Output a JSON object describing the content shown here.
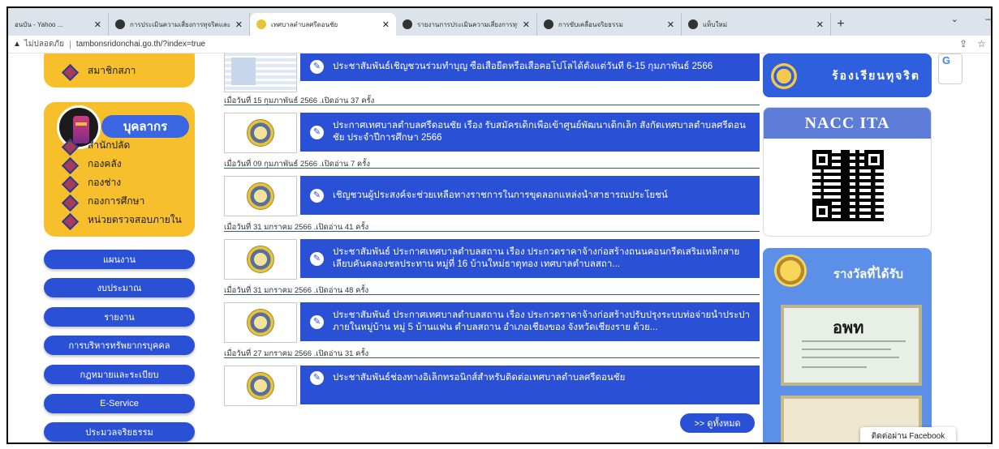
{
  "browser": {
    "tabs": [
      {
        "label": "อนบัน - Yahoo ...",
        "icon": "yahoo-icon",
        "color": "#6001d2"
      },
      {
        "label": "การประเมินความเสี่ยงการทุจริตและ...",
        "icon": "chrome-icon",
        "color": "#333333"
      },
      {
        "label": "เทศบาลตำบลศรีดอนชัย",
        "icon": "site-icon",
        "color": "#e8c33a",
        "active": true
      },
      {
        "label": "รายงานการประเมินความเสี่ยงการทุจ...",
        "icon": "chrome-icon",
        "color": "#333333"
      },
      {
        "label": "การขับเคลื่อนจริยธรรม",
        "icon": "chrome-icon",
        "color": "#333333"
      },
      {
        "label": "แท็บใหม่",
        "icon": "chrome-icon",
        "color": "#333333"
      }
    ],
    "new_tab": "+",
    "address": {
      "insecure_label": "ไม่ปลอดภัย",
      "url": "tambonsridonchai.go.th/?index=true"
    }
  },
  "sidebar": {
    "top_item": "สมาชิกสภา",
    "section_title": "บุคลากร",
    "items": [
      "สำนักปลัด",
      "กองคลัง",
      "กองช่าง",
      "กองการศึกษา",
      "หน่วยตรวจสอบภายใน"
    ],
    "buttons": [
      "แผนงาน",
      "งบประมาณ",
      "รายงาน",
      "การบริหารทรัพยากรบุคคล",
      "กฎหมายและระเบียบ",
      "E-Service",
      "ประมวลจริยธรรม"
    ]
  },
  "news": [
    {
      "title": "ประชาสัมพันธ์เชิญชวนร่วมทำบุญ ซื้อเสื้อยืดหรือเสื้อคอโปโลได้ตั้งแต่วันที่ 6-15 กุมภาพันธ์ 2566",
      "meta": "เมื่อวันที่ 15 กุมภาพันธ์ 2566 .เปิดอ่าน 37 ครั้ง",
      "thumb": "doc"
    },
    {
      "title": "ประกาศเทศบาลตำบลศรีดอนชัย เรื่อง รับสมัครเด็กเพื่อเข้าศูนย์พัฒนาเด็กเล็ก สังกัดเทศบาลตำบลศรีดอนชัย ประจำปีการศึกษา 2566",
      "meta": "เมื่อวันที่ 09 กุมภาพันธ์ 2566 .เปิดอ่าน 7 ครั้ง",
      "thumb": "seal"
    },
    {
      "title": "เชิญชวนผู้ประสงค์จะช่วยเหลือทางราชการในการขุดลอกแหล่งน้ำสาธารณประโยชน์",
      "meta": "เมื่อวันที่ 31 มกราคม 2566 .เปิดอ่าน 41 ครั้ง",
      "thumb": "seal"
    },
    {
      "title": "ประชาสัมพันธ์ ประกาศเทศบาลตำบลสถาน เรื่อง ประกวดราคาจ้างก่อสร้างถนนคอนกรีตเสริมเหล็กสายเลียบคันคลองชลประทาน หมู่ที่ 16 บ้านใหม่ธาตุทอง เทศบาลตำบลสถา...",
      "meta": "เมื่อวันที่ 31 มกราคม 2566 .เปิดอ่าน 48 ครั้ง",
      "thumb": "seal"
    },
    {
      "title": "ประชาสัมพันธ์ ประกาศเทศบาลตำบลสถาน เรื่อง ประกวดราคาจ้างก่อสร้างปรับปรุงระบบท่อจ่ายน้ำประปาภายในหมู่บ้าน หมู่ 5 บ้านแฟน ตำบลสถาน อำเภอเชียงของ จังหวัดเชียงราย ด้วย...",
      "meta": "เมื่อวันที่ 27 มกราคม 2566 .เปิดอ่าน 31 ครั้ง",
      "thumb": "seal"
    },
    {
      "title": "ประชาสัมพันธ์ช่องทางอิเล็กทรอนิกส์สำหรับติดต่อเทศบาลตำบลศรีดอนชัย",
      "meta": "",
      "thumb": "seal"
    }
  ],
  "see_all": ">> ดูทั้งหมด",
  "right": {
    "banner1": "ร้องเรียนทุจริต",
    "nacc_title": "NACC ITA",
    "award_title": "รางวัลที่ได้รับ",
    "cert_text": "อพท",
    "g_letter": "G"
  },
  "fb_chip": "ติดต่อผ่าน Facebook",
  "colors": {
    "primary_blue": "#2a50d6",
    "yellow": "#f7bf2b",
    "award_blue": "#5b8fe8"
  }
}
